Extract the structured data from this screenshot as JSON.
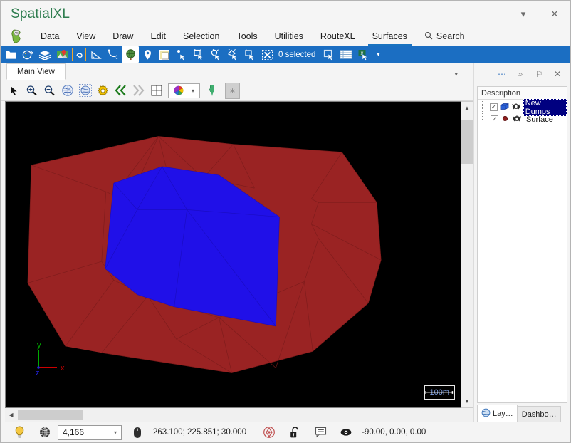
{
  "window": {
    "title": "SpatialXL",
    "minimize_label": "▾",
    "close_label": "✕"
  },
  "menubar": {
    "logo_name": "spatialxl-logo-icon",
    "items": [
      {
        "label": "Data",
        "active": false
      },
      {
        "label": "View",
        "active": false
      },
      {
        "label": "Draw",
        "active": false
      },
      {
        "label": "Edit",
        "active": false
      },
      {
        "label": "Selection",
        "active": false
      },
      {
        "label": "Tools",
        "active": false
      },
      {
        "label": "Utilities",
        "active": false
      },
      {
        "label": "RouteXL",
        "active": false
      },
      {
        "label": "Surfaces",
        "active": true
      }
    ],
    "search_label": "Search",
    "search_icon": "magnifier-icon"
  },
  "ribbon": {
    "background": "#1b6ec2",
    "selection_count_label": "0 selected",
    "overflow_caret": "▾",
    "icons": [
      "open-folder-icon",
      "palette-globe-icon",
      "layers-stack-icon",
      "map-pin-image-icon",
      "boundary-icon",
      "measure-angle-icon",
      "curve-tool-icon",
      "globe-icon",
      "location-pin-icon",
      "page-layout-icon",
      "select-point-icon",
      "select-rectangle-icon",
      "select-zoom-icon",
      "select-lasso-icon",
      "select-crop-icon",
      "clear-selection-icon",
      "duplicate-selection-icon",
      "table-view-icon",
      "export-excel-icon"
    ]
  },
  "document": {
    "tab_label": "Main View",
    "tabstrip_caret": "▾"
  },
  "viewtoolbar": {
    "icons": [
      "pointer-icon",
      "zoom-in-icon",
      "zoom-out-icon",
      "globe-view-icon",
      "globe-select-icon",
      "settings-gear-icon",
      "rewind-icon",
      "fast-forward-icon",
      "grid-icon"
    ],
    "color_combo_icon": "color-palette-icon",
    "color_combo_caret": "▾",
    "bookmark_icon": "green-flag-icon",
    "star_button_label": "∗"
  },
  "viewport": {
    "background_color": "#000000",
    "scale_bar_label": "100m",
    "axis": {
      "x_label": "x",
      "y_label": "y",
      "z_label": "z",
      "x_color": "#cc0000",
      "y_color": "#00aa00",
      "z_color": "#2222dd"
    },
    "surfaces": [
      {
        "name": "Surface",
        "color": "#9a2323",
        "outline_color": "#7e1c1c"
      },
      {
        "name": "New Dumps",
        "color": "#2010e8",
        "outline_color": "#1a0cc0"
      }
    ],
    "vscroll_up": "▲",
    "vscroll_down": "▼",
    "hscroll_left": "◀"
  },
  "rightpanel": {
    "toolbar_buttons": [
      {
        "name": "more-options-icon",
        "label": "⋯"
      },
      {
        "name": "collapse-panel-icon",
        "label": "»"
      },
      {
        "name": "pin-icon",
        "label": "⚐"
      },
      {
        "name": "close-panel-icon",
        "label": "✕"
      }
    ],
    "list_header": "Description",
    "rows": [
      {
        "name": "New Dumps",
        "checked": true,
        "check_glyph": "✓",
        "type_icon": "solid-block-icon",
        "type_color": "#2a5fd4",
        "visibility_icon": "eye-visible-icon",
        "selected": true
      },
      {
        "name": "Surface",
        "checked": true,
        "check_glyph": "✓",
        "type_icon": "point-icon",
        "type_color": "#8e1f1f",
        "visibility_icon": "eye-visible-icon",
        "selected": false
      }
    ],
    "tabs": [
      {
        "label": "Lay…",
        "icon": "globe-icon",
        "active": true
      },
      {
        "label": "Dashbo…",
        "icon": "",
        "active": false
      }
    ]
  },
  "statusbar": {
    "lightbulb_icon": "lightbulb-icon",
    "globe_icon": "globe-wire-icon",
    "zoom_value": "4,166",
    "zoom_caret": "▾",
    "mouse_icon": "mouse-icon",
    "coordinates": "263.100; 225.851; 30.000",
    "snap_icon": "snap-target-icon",
    "lock_icon": "unlocked-padlock-icon",
    "note_icon": "comment-icon",
    "view_icon": "eye-icon",
    "view_angles": "-90.00, 0.00, 0.00"
  }
}
